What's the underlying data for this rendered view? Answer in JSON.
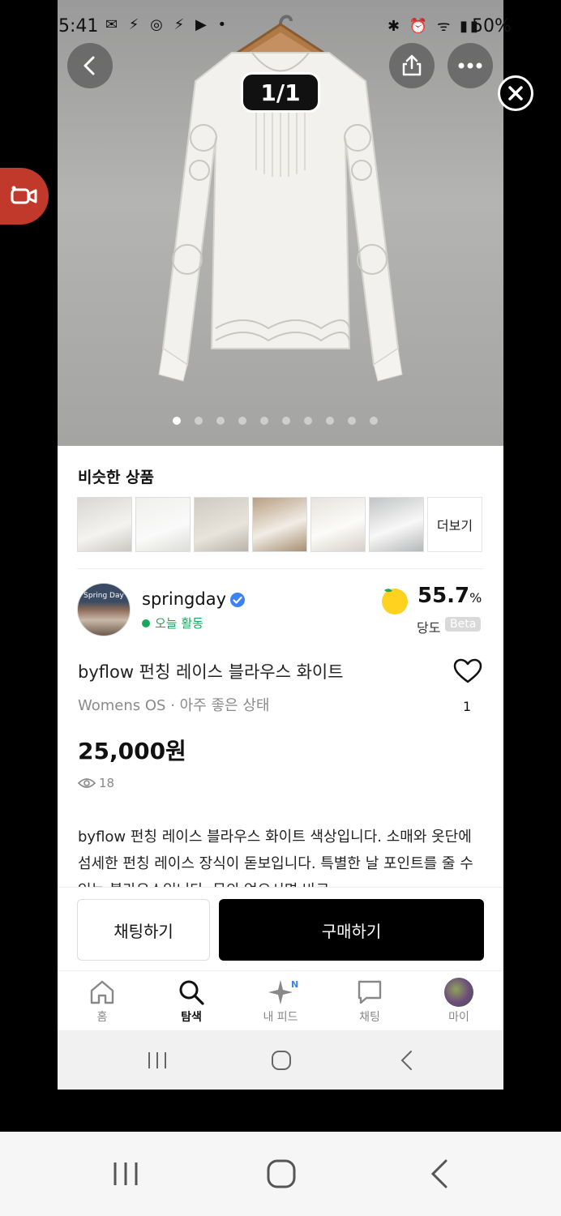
{
  "status_bar": {
    "time": "5:41",
    "battery": "50%"
  },
  "hero": {
    "image_counter": "1/1",
    "dot_count": 10,
    "active_dot": 0
  },
  "similar": {
    "title": "비슷한 상품",
    "more_label": "더보기"
  },
  "seller": {
    "name": "springday",
    "status": "오늘 활동",
    "avatar_sign": "Spring Day",
    "sweetness_value": "55.7",
    "sweetness_unit": "%",
    "sweetness_label": "당도",
    "beta_badge": "Beta"
  },
  "product": {
    "title": "byflow 펀칭 레이스 블라우스 화이트",
    "meta": "Womens OS · 아주 좋은 상태",
    "price": "25,000원",
    "views": "18",
    "likes": "1",
    "description": "byflow 펀칭 레이스 블라우스 화이트 색상입니다. 소매와 옷단에 섬세한 펀칭 레이스 장식이 돋보입니다. 특별한 날 포인트를 줄 수 있는 블라우스입니다. 문의 없으시면 바로"
  },
  "actions": {
    "chat_label": "채팅하기",
    "buy_label": "구매하기"
  },
  "tabbar": {
    "items": [
      {
        "label": "홈",
        "icon": "home-icon"
      },
      {
        "label": "탐색",
        "icon": "search-icon"
      },
      {
        "label": "내 피드",
        "icon": "sparkle-icon"
      },
      {
        "label": "채팅",
        "icon": "chat-icon"
      },
      {
        "label": "마이",
        "icon": "profile-icon"
      }
    ],
    "active_index": 1,
    "feed_badge": "N"
  },
  "colors": {
    "accent_green": "#1aa75b",
    "primary_black": "#000000",
    "verified_blue": "#3b82f6"
  }
}
